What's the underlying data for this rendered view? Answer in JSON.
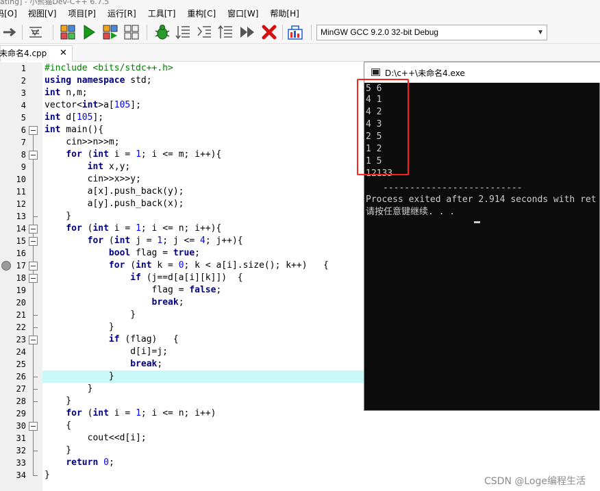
{
  "window": {
    "title_fragment": "ating] - 小熊猫Dev-C++ 6.7.5"
  },
  "menu": [
    "码[O]",
    "视图[V]",
    "项目[P]",
    "运行[R]",
    "工具[T]",
    "重构[C]",
    "窗口[W]",
    "帮助[H]"
  ],
  "toolbar": {
    "compiler": "MinGW GCC 9.2.0 32-bit Debug",
    "icons": [
      "redo-arrow-icon",
      "indent-icon",
      "compile-icon",
      "run-icon",
      "compile-run-icon",
      "rebuild-icon",
      "debug-icon",
      "step-icon",
      "step-into-icon",
      "step-out-icon",
      "continue-icon",
      "stop-icon",
      "profile-icon"
    ]
  },
  "tab": {
    "label": "未命名4.cpp",
    "close": "✕"
  },
  "editor": {
    "lines": [
      {
        "n": "1",
        "code": "#include <bits/stdc++.h>"
      },
      {
        "n": "2",
        "code": "using namespace std;"
      },
      {
        "n": "3",
        "code": "int n,m;"
      },
      {
        "n": "4",
        "code": "vector<int>a[105];"
      },
      {
        "n": "5",
        "code": "int d[105];"
      },
      {
        "n": "6",
        "code": "int main(){"
      },
      {
        "n": "7",
        "code": "    cin>>n>>m;"
      },
      {
        "n": "8",
        "code": "    for (int i = 1; i <= m; i++){"
      },
      {
        "n": "9",
        "code": "        int x,y;"
      },
      {
        "n": "10",
        "code": "        cin>>x>>y;"
      },
      {
        "n": "11",
        "code": "        a[x].push_back(y);"
      },
      {
        "n": "12",
        "code": "        a[y].push_back(x);"
      },
      {
        "n": "13",
        "code": "    }"
      },
      {
        "n": "14",
        "code": "    for (int i = 1; i <= n; i++){"
      },
      {
        "n": "15",
        "code": "        for (int j = 1; j <= 4; j++){"
      },
      {
        "n": "16",
        "code": "            bool flag = true;"
      },
      {
        "n": "17",
        "code": "            for (int k = 0; k < a[i].size(); k++)   {"
      },
      {
        "n": "18",
        "code": "                if (j==d[a[i][k]])  {"
      },
      {
        "n": "19",
        "code": "                    flag = false;"
      },
      {
        "n": "20",
        "code": "                    break;"
      },
      {
        "n": "21",
        "code": "                }"
      },
      {
        "n": "22",
        "code": "            }"
      },
      {
        "n": "23",
        "code": "            if (flag)   {"
      },
      {
        "n": "24",
        "code": "                d[i]=j;"
      },
      {
        "n": "25",
        "code": "                break;"
      },
      {
        "n": "26",
        "code": "            }"
      },
      {
        "n": "27",
        "code": "        }"
      },
      {
        "n": "28",
        "code": "    }"
      },
      {
        "n": "29",
        "code": "    for (int i = 1; i <= n; i++)"
      },
      {
        "n": "30",
        "code": "    {"
      },
      {
        "n": "31",
        "code": "        cout<<d[i];"
      },
      {
        "n": "32",
        "code": "    }"
      },
      {
        "n": "33",
        "code": "    return 0;"
      },
      {
        "n": "34",
        "code": "}"
      }
    ],
    "highlighted_line": "26",
    "breakpoint_line": "17"
  },
  "console": {
    "title": "D:\\c++\\未命名4.exe",
    "output": [
      "5 6",
      "4 1",
      "4 2",
      "4 3",
      "2 5",
      "1 2",
      "1 5",
      "12133"
    ],
    "separator": "--------------------------",
    "exit_message": "Process exited after 2.914 seconds with ret",
    "prompt": "请按任意键继续. . ."
  },
  "watermark": "CSDN @Loge编程生活",
  "colors": {
    "highlight": "#c8f8f8",
    "keyword": "#000080",
    "number": "#0000ff",
    "annotation_box": "#ff2020"
  }
}
